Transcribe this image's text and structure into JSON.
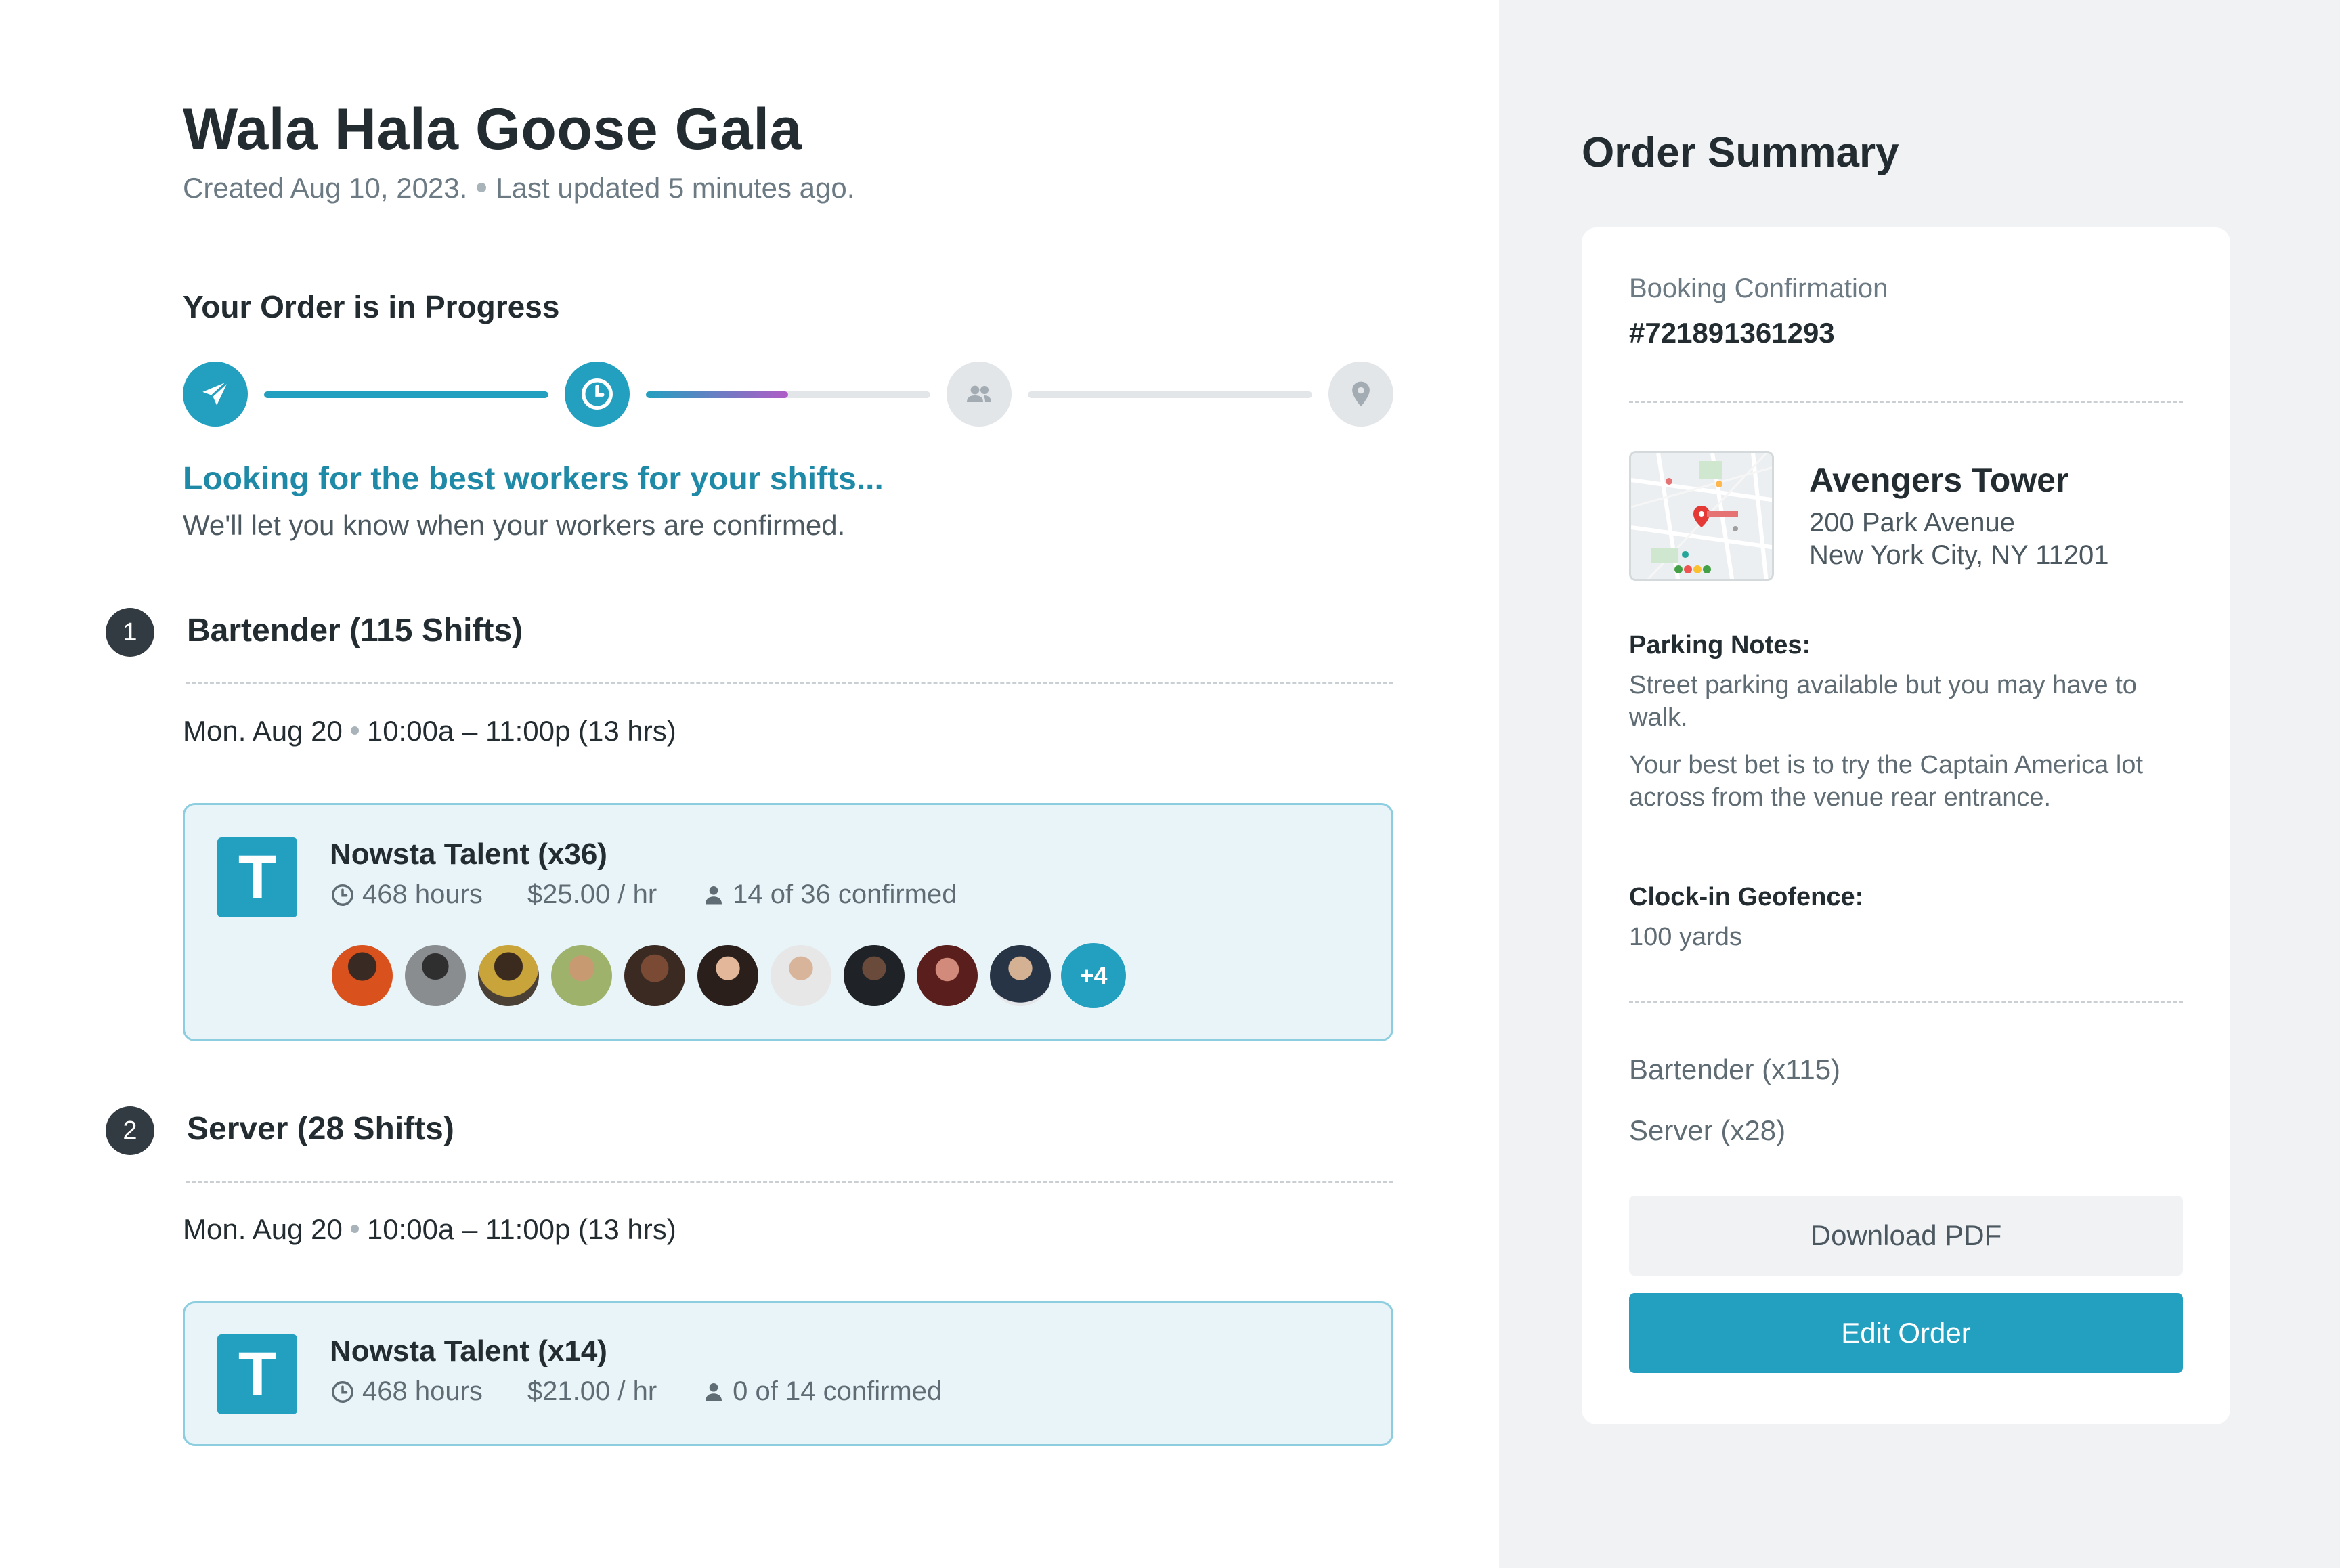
{
  "event": {
    "title": "Wala Hala Goose Gala",
    "created": "Created Aug 10, 2023.",
    "updated": "Last updated 5 minutes ago."
  },
  "progress": {
    "heading": "Your Order is in Progress",
    "steps": [
      {
        "icon": "paper-plane-icon",
        "state": "done"
      },
      {
        "icon": "clock-icon",
        "state": "active"
      },
      {
        "icon": "people-icon",
        "state": "pending"
      },
      {
        "icon": "location-pin-icon",
        "state": "pending"
      }
    ],
    "segment_fill": [
      1.0,
      0.5,
      0.0
    ],
    "status_title": "Looking for the best workers for your shifts...",
    "status_text": "We'll let you know when your workers are confirmed."
  },
  "roles": [
    {
      "number": "1",
      "title": "Bartender (115 Shifts)",
      "date": "Mon. Aug 20",
      "time": "10:00a – 11:00p (13 hrs)",
      "talent": {
        "logo": "T",
        "name": "Nowsta Talent (x36)",
        "hours": "468 hours",
        "rate": "$25.00 / hr",
        "confirmed": "14 of 36 confirmed",
        "more": "+4"
      }
    },
    {
      "number": "2",
      "title": "Server (28 Shifts)",
      "date": "Mon. Aug 20",
      "time": "10:00a – 11:00p (13 hrs)",
      "talent": {
        "logo": "T",
        "name": "Nowsta Talent (x14)",
        "hours": "468 hours",
        "rate": "$21.00 / hr",
        "confirmed": "0 of 14 confirmed"
      }
    }
  ],
  "summary": {
    "title": "Order Summary",
    "booking_label": "Booking Confirmation",
    "booking_number": "#721891361293",
    "venue_name": "Avengers Tower",
    "address_line1": "200 Park Avenue",
    "address_line2": "New York City, NY 11201",
    "parking_label": "Parking Notes:",
    "parking_text1": "Street parking available but you may have to walk.",
    "parking_text2": "Your best bet is to try the Captain America lot across from the venue rear entrance.",
    "geofence_label": "Clock-in Geofence:",
    "geofence_value": "100 yards",
    "roles": [
      "Bartender (x115)",
      "Server (x28)"
    ],
    "download_label": "Download PDF",
    "edit_label": "Edit Order"
  },
  "colors": {
    "accent": "#23a0c0",
    "accent_dark": "#1f8aa8",
    "gradient_end": "#b05cc6",
    "card_bg": "#e9f4f8",
    "sidebar_bg": "#f0f2f4"
  }
}
